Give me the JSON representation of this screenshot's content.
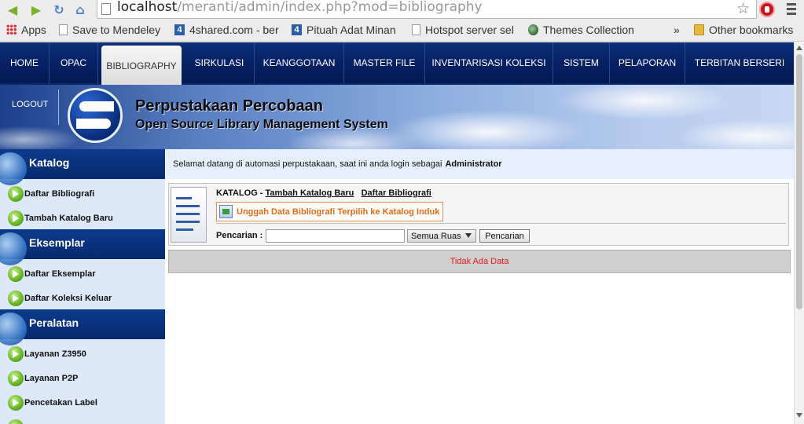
{
  "browser": {
    "url_host": "localhost",
    "url_path": "/meranti/admin/index.php?mod=bibliography"
  },
  "bookmarks": {
    "items": [
      {
        "label": "Apps",
        "icon": "apps-icon"
      },
      {
        "label": "Save to Mendeley",
        "icon": "page-icon"
      },
      {
        "label": "4shared.com - ber",
        "icon": "4shared-icon"
      },
      {
        "label": "Pituah Adat Minan",
        "icon": "4shared-icon"
      },
      {
        "label": "Hotspot server sel",
        "icon": "page-icon"
      },
      {
        "label": "Themes Collection",
        "icon": "theme-icon"
      }
    ],
    "more": "»",
    "other": "Other bookmarks"
  },
  "topnav": {
    "items": [
      "HOME",
      "OPAC",
      "BIBLIOGRAPHY",
      "SIRKULASI",
      "KEANGGOTAAN",
      "MASTER FILE",
      "INVENTARISASI KOLEKSI",
      "SISTEM",
      "PELAPORAN",
      "TERBITAN BERSERI"
    ],
    "active": "BIBLIOGRAPHY"
  },
  "banner": {
    "logout": "LOGOUT",
    "title": "Perpustakaan Percobaan",
    "subtitle": "Open Source Library Management System"
  },
  "sidebar": {
    "sections": [
      {
        "title": "Katalog",
        "items": [
          "Daftar Bibliografi",
          "Tambah Katalog Baru"
        ]
      },
      {
        "title": "Eksemplar",
        "items": [
          "Daftar Eksemplar",
          "Daftar Koleksi Keluar"
        ]
      },
      {
        "title": "Peralatan",
        "items": [
          "Layanan Z3950",
          "Layanan P2P",
          "Pencetakan Label"
        ]
      }
    ]
  },
  "welcome": {
    "text": "Selamat datang di automasi perpustakaan, saat ini anda login sebagai",
    "user": "Administrator"
  },
  "panel": {
    "title_prefix": "KATALOG -",
    "link_add": "Tambah Katalog Baru",
    "link_list": "Daftar Bibliografi",
    "upload_label": "Unggah Data Bibliografi Terpilih ke Katalog Induk",
    "search_label": "Pencarian :",
    "search_value": "",
    "select_value": "Semua Ruas",
    "search_button": "Pencarian"
  },
  "results": {
    "empty_text": "Tidak Ada Data"
  },
  "colors": {
    "nav_bg": "#062061",
    "accent_orange": "#e86a14",
    "nodata_red": "#e51c1c",
    "sidebar_bg": "#dde9f9"
  }
}
